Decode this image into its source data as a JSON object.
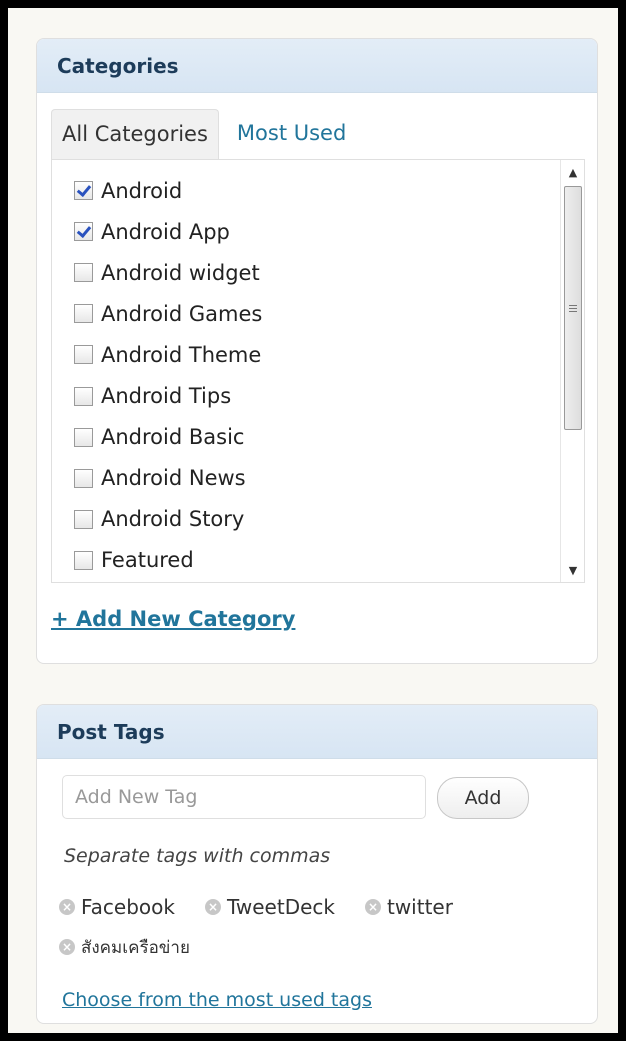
{
  "categories_box": {
    "title": "Categories",
    "tabs": [
      {
        "label": "All Categories",
        "active": true
      },
      {
        "label": "Most Used",
        "active": false
      }
    ],
    "items": [
      {
        "label": "Android",
        "checked": true
      },
      {
        "label": "Android App",
        "checked": true
      },
      {
        "label": "Android widget",
        "checked": false
      },
      {
        "label": "Android Games",
        "checked": false
      },
      {
        "label": "Android Theme",
        "checked": false
      },
      {
        "label": "Android Tips",
        "checked": false
      },
      {
        "label": "Android Basic",
        "checked": false
      },
      {
        "label": "Android News",
        "checked": false
      },
      {
        "label": "Android Story",
        "checked": false
      },
      {
        "label": "Featured",
        "checked": false
      }
    ],
    "add_link": "+ Add New Category"
  },
  "tags_box": {
    "title": "Post Tags",
    "input_placeholder": "Add New Tag",
    "add_button": "Add",
    "hint": "Separate tags with commas",
    "tags": [
      "Facebook",
      "TweetDeck",
      "twitter",
      "สังคมเครือข่าย"
    ],
    "choose_link": "Choose from the most used tags"
  },
  "colors": {
    "header_bg": "#dfe9f4",
    "link": "#21759b",
    "title_text": "#1d3c5a"
  }
}
